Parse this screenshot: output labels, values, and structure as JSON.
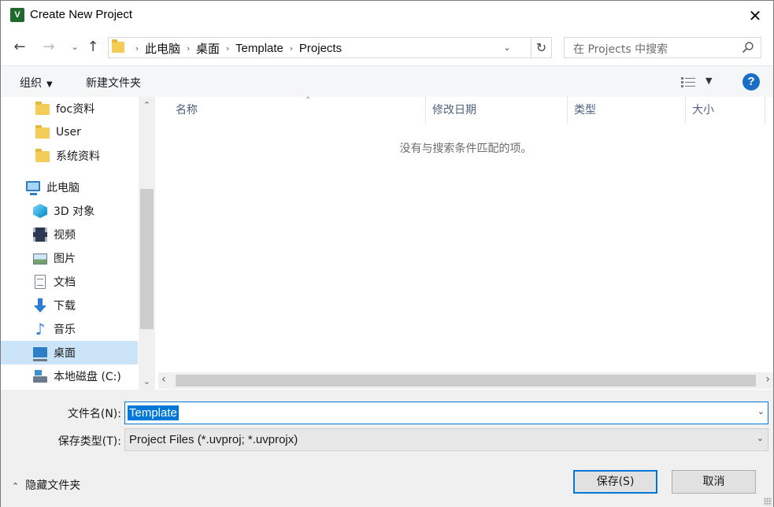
{
  "window": {
    "title": "Create New Project",
    "app_icon_text": "V",
    "close_glyph": "✕"
  },
  "nav": {
    "back_glyph": "←",
    "forward_glyph": "→",
    "recent_glyph": "⌄",
    "up_glyph": "↑"
  },
  "address": {
    "crumbs": [
      "此电脑",
      "桌面",
      "Template",
      "Projects"
    ],
    "sep_glyph": "›",
    "dropdown_glyph": "⌄",
    "refresh_glyph": "↻"
  },
  "search": {
    "placeholder": "在 Projects 中搜索"
  },
  "toolbar": {
    "organize_label": "组织",
    "organize_arrow": "▼",
    "new_folder_label": "新建文件夹",
    "view_arrow": "▼",
    "help_glyph": "?"
  },
  "sidebar": {
    "items": [
      {
        "label": "foc资料",
        "icon": "folder-icon"
      },
      {
        "label": "User",
        "icon": "folder-icon"
      },
      {
        "label": "系统资料",
        "icon": "folder-icon"
      },
      {
        "label": "此电脑",
        "icon": "computer-icon"
      },
      {
        "label": "3D 对象",
        "icon": "3d-objects-icon"
      },
      {
        "label": "视频",
        "icon": "video-icon"
      },
      {
        "label": "图片",
        "icon": "pictures-icon"
      },
      {
        "label": "文档",
        "icon": "documents-icon"
      },
      {
        "label": "下载",
        "icon": "download-icon"
      },
      {
        "label": "音乐",
        "icon": "music-icon"
      },
      {
        "label": "桌面",
        "icon": "desktop-icon",
        "selected": true
      },
      {
        "label": "本地磁盘 (C:)",
        "icon": "drive-icon"
      }
    ],
    "scroll_up": "⌃",
    "scroll_down": "⌄"
  },
  "content": {
    "columns": [
      "名称",
      "修改日期",
      "类型",
      "大小"
    ],
    "sort_glyph": "⌃",
    "empty_message": "没有与搜索条件匹配的项。",
    "hscroll_left": "‹",
    "hscroll_right": "›"
  },
  "form": {
    "filename_label": "文件名(N):",
    "filename_value": "Template",
    "filetype_label": "保存类型(T):",
    "filetype_value": "Project Files (*.uvproj; *.uvprojx)",
    "dropdown_glyph": "⌄"
  },
  "footer": {
    "hide_folders_glyph": "⌃",
    "hide_folders_label": "隐藏文件夹",
    "save_label": "保存(S)",
    "cancel_label": "取消"
  },
  "colors": {
    "accent": "#0078d7",
    "selection": "#cce4f7",
    "help": "#1a6ec7"
  }
}
